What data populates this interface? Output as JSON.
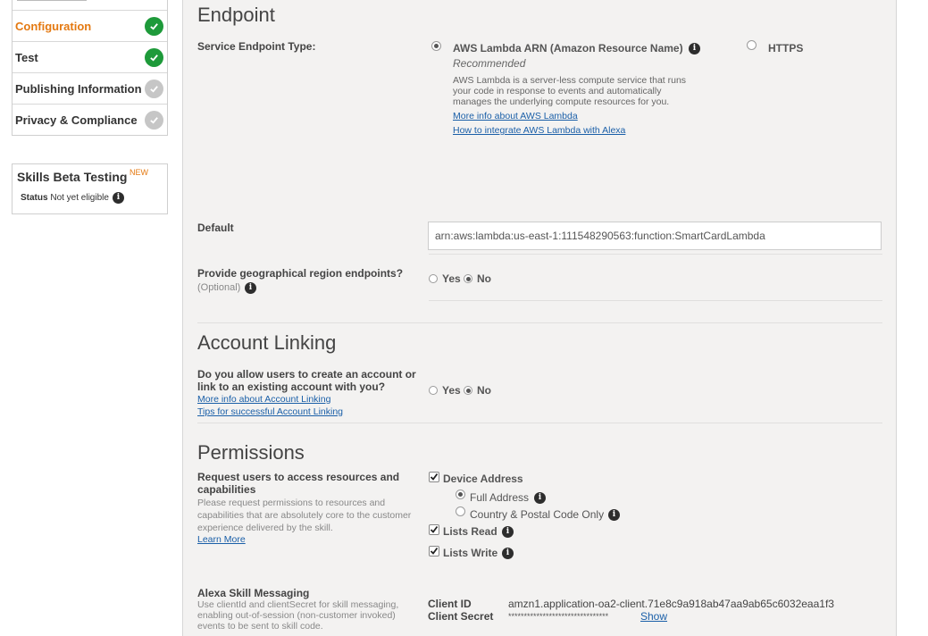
{
  "sidebar": {
    "items": [
      {
        "label": "Configuration",
        "state": "complete",
        "active": true
      },
      {
        "label": "Test",
        "state": "complete",
        "active": false
      },
      {
        "label": "Publishing Information",
        "state": "pending",
        "active": false
      },
      {
        "label": "Privacy & Compliance",
        "state": "pending",
        "active": false
      }
    ],
    "beta": {
      "title": "Skills Beta Testing",
      "new_badge": "NEW",
      "status_label": "Status",
      "status_value": "Not yet eligible"
    }
  },
  "endpoint": {
    "heading": "Endpoint",
    "type_label": "Service Endpoint Type:",
    "lambda_label": "AWS Lambda ARN (Amazon Resource Name)",
    "lambda_selected": true,
    "recommended": "Recommended",
    "lambda_desc": [
      "AWS Lambda is a server-less compute service that runs",
      "your code in response to events and automatically",
      "manages the underlying compute resources for you."
    ],
    "link_more": "More info about AWS Lambda",
    "link_integrate": "How to integrate AWS Lambda with Alexa",
    "https_label": "HTTPS",
    "https_selected": false,
    "default_label": "Default",
    "default_value": "arn:aws:lambda:us-east-1:111548290563:function:SmartCardLambda",
    "geo_label": "Provide geographical region endpoints?",
    "geo_optional": "(Optional)",
    "geo_yes": "Yes",
    "geo_no": "No",
    "geo_selected": "No"
  },
  "account_linking": {
    "heading": "Account Linking",
    "question": [
      "Do you allow users to create an account or",
      "link to an existing account with you?"
    ],
    "link_more": "More info about Account Linking",
    "link_tips": "Tips for successful Account Linking",
    "yes": "Yes",
    "no": "No",
    "selected": "No"
  },
  "permissions": {
    "heading": "Permissions",
    "request_label": [
      "Request users to access resources and",
      "capabilities"
    ],
    "request_desc": [
      "Please request permissions to resources and",
      "capabilities that are absolutely core to the customer",
      "experience delivered by the skill."
    ],
    "learn_more": "Learn More",
    "device_address": "Device Address",
    "device_address_checked": true,
    "full_address": "Full Address",
    "full_address_selected": true,
    "country_postal": "Country & Postal Code Only",
    "country_postal_selected": false,
    "lists_read": "Lists Read",
    "lists_read_checked": true,
    "lists_write": "Lists Write",
    "lists_write_checked": true
  },
  "messaging": {
    "label": "Alexa Skill Messaging",
    "desc": [
      "Use clientId and clientSecret for skill messaging,",
      "enabling out-of-session (non-customer invoked)",
      "events to be sent to skill code."
    ],
    "client_id_label": "Client ID",
    "client_id_value": "amzn1.application-oa2-client.71e8c9a918ab47aa9ab65c6032eaa1f3",
    "client_secret_label": "Client Secret",
    "client_secret_value": "********************************",
    "show_label": "Show"
  },
  "colors": {
    "accent_orange": "#e47911",
    "check_green": "#1e9a3a",
    "link_blue": "#1a5fa8"
  }
}
